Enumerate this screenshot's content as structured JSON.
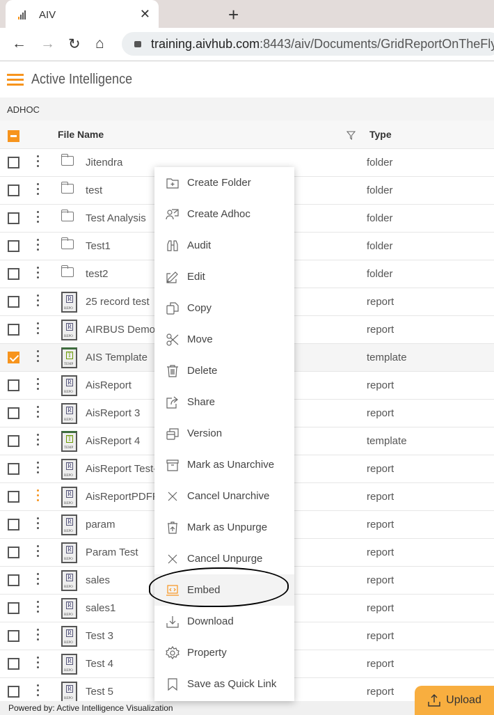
{
  "browser": {
    "tab_title": "AIV",
    "url_host": "training.aivhub.com",
    "url_rest": ":8443/aiv/Documents/GridReportOnTheFly"
  },
  "app": {
    "title": "Active Intelligence",
    "breadcrumb": "ADHOC",
    "accent": "#f7941d"
  },
  "grid": {
    "col_name": "File Name",
    "col_type": "Type",
    "rows": [
      {
        "name": "Jitendra",
        "type": "folder",
        "kind": "folder"
      },
      {
        "name": "test",
        "type": "folder",
        "kind": "folder"
      },
      {
        "name": "Test Analysis",
        "type": "folder",
        "kind": "folder"
      },
      {
        "name": "Test1",
        "type": "folder",
        "kind": "folder"
      },
      {
        "name": "test2",
        "type": "folder",
        "kind": "folder"
      },
      {
        "name": "25 record test",
        "type": "report",
        "kind": "report"
      },
      {
        "name": "AIRBUS Demo",
        "type": "report",
        "kind": "report"
      },
      {
        "name": "AIS Template",
        "type": "template",
        "kind": "template",
        "checked": true
      },
      {
        "name": "AisReport",
        "type": "report",
        "kind": "report"
      },
      {
        "name": "AisReport 3",
        "type": "report",
        "kind": "report"
      },
      {
        "name": "AisReport 4",
        "type": "template",
        "kind": "template"
      },
      {
        "name": "AisReport Test-",
        "type": "report",
        "kind": "report"
      },
      {
        "name": "AisReportPDFF",
        "type": "report",
        "kind": "report",
        "active_menu": true
      },
      {
        "name": "param",
        "type": "report",
        "kind": "report"
      },
      {
        "name": "Param Test",
        "type": "report",
        "kind": "report"
      },
      {
        "name": "sales",
        "type": "report",
        "kind": "report"
      },
      {
        "name": "sales1",
        "type": "report",
        "kind": "report"
      },
      {
        "name": "Test 3",
        "type": "report",
        "kind": "report"
      },
      {
        "name": "Test 4",
        "type": "report",
        "kind": "report"
      },
      {
        "name": "Test 5",
        "type": "report",
        "kind": "report"
      }
    ]
  },
  "menu": {
    "items": [
      {
        "label": "Create Folder",
        "icon": "folder-plus-icon"
      },
      {
        "label": "Create Adhoc",
        "icon": "create-adhoc-icon"
      },
      {
        "label": "Audit",
        "icon": "binoculars-icon"
      },
      {
        "label": "Edit",
        "icon": "edit-icon"
      },
      {
        "label": "Copy",
        "icon": "copy-icon"
      },
      {
        "label": "Move",
        "icon": "scissors-icon"
      },
      {
        "label": "Delete",
        "icon": "trash-icon"
      },
      {
        "label": "Share",
        "icon": "share-icon"
      },
      {
        "label": "Version",
        "icon": "version-icon"
      },
      {
        "label": "Mark as Unarchive",
        "icon": "archive-icon"
      },
      {
        "label": "Cancel Unarchive",
        "icon": "x-icon"
      },
      {
        "label": "Mark as Unpurge",
        "icon": "unpurge-icon"
      },
      {
        "label": "Cancel Unpurge",
        "icon": "x-icon"
      },
      {
        "label": "Embed",
        "icon": "embed-icon",
        "highlighted": true
      },
      {
        "label": "Download",
        "icon": "download-icon"
      },
      {
        "label": "Property",
        "icon": "gear-icon"
      },
      {
        "label": "Save as Quick Link",
        "icon": "bookmark-icon"
      }
    ]
  },
  "footer": {
    "text": "Powered by: Active Intelligence Visualization"
  },
  "upload": {
    "label": "Upload"
  }
}
